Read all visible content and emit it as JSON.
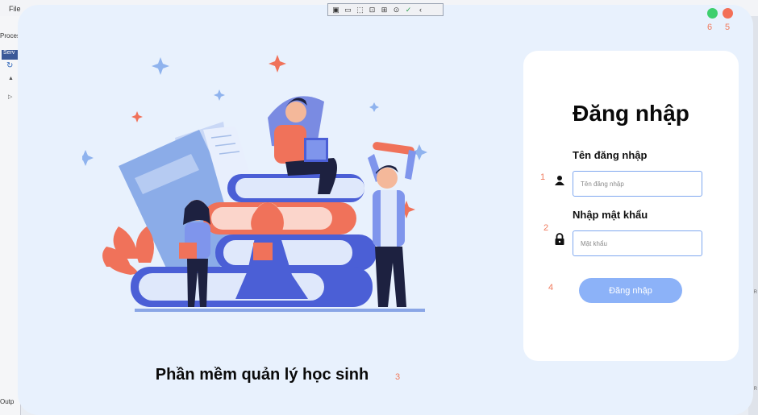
{
  "ide": {
    "menu": [
      "File",
      "Proces"
    ],
    "left_tab": "Serv",
    "bottom_left": "Outp",
    "debug_toolbar": [
      "▣",
      "▭",
      "⬚",
      "⊡",
      "⊞",
      "⊙",
      "✓",
      "‹"
    ],
    "right_markers": [
      "R",
      "R"
    ]
  },
  "window": {
    "hint_6": "6",
    "hint_5": "5",
    "colors": {
      "green": "#3ecf6e",
      "red": "#f36f57"
    }
  },
  "main": {
    "app_title": "Phần mềm quản lý học sinh",
    "hint_3": "3"
  },
  "login": {
    "title": "Đăng nhập",
    "username_label": "Tên đăng nhập",
    "username_placeholder": "Tên đăng nhập",
    "password_label": "Nhập mật khẩu",
    "password_placeholder": "Mật khẩu",
    "button_label": "Đăng nhập",
    "hint_1": "1",
    "hint_2": "2",
    "hint_4": "4",
    "accent": "#8cb2f8"
  },
  "icons": {
    "user": "user-icon",
    "lock": "lock-icon"
  }
}
